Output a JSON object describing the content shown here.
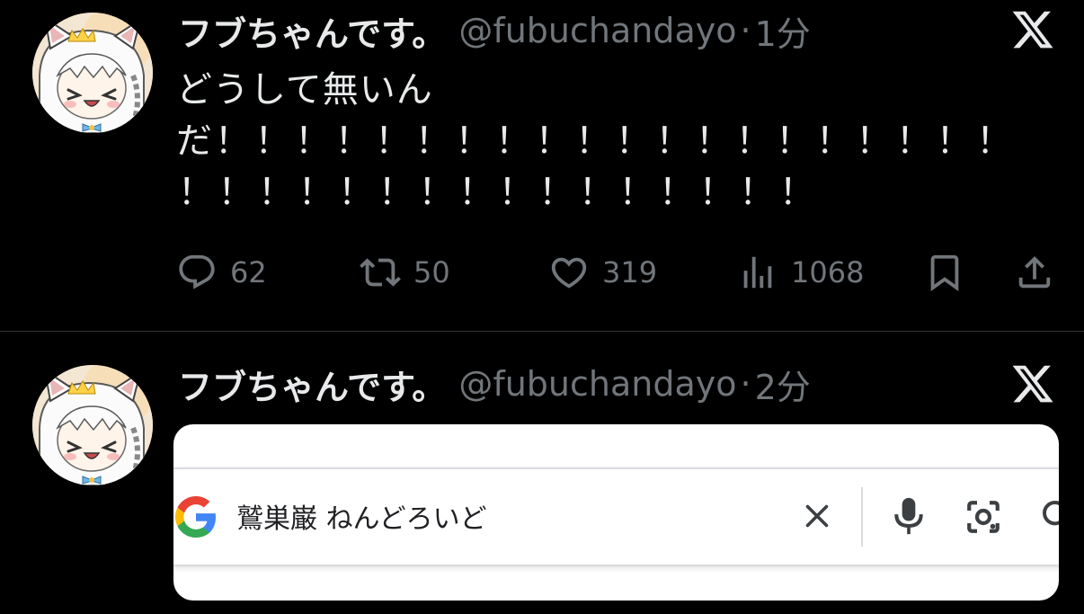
{
  "tweets": [
    {
      "display_name": "フブちゃんです。",
      "handle": "@fubuchandayo",
      "separator": "·",
      "time": "1分",
      "text_line1": "どうして無いん",
      "text_line2_prefix": "だ",
      "text_line2_bangs": "！！！！！！！！！！！！！！！！！！！！",
      "text_line3_bangs": "！！！！！！！！！！！！！！！！",
      "stats": {
        "replies": "62",
        "retweets": "50",
        "likes": "319",
        "views": "1068"
      }
    },
    {
      "display_name": "フブちゃんです。",
      "handle": "@fubuchandayo",
      "separator": "·",
      "time": "2分",
      "search_card": {
        "query": "鷲巣巌 ねんどろいど"
      }
    }
  ],
  "icons": {
    "platform_logo": "x-logo-icon",
    "reply": "speech-bubble-icon",
    "retweet": "retweet-icon",
    "like": "heart-icon",
    "views": "bar-chart-icon",
    "bookmark": "bookmark-icon",
    "share": "share-icon",
    "search_card": [
      "google-g-icon",
      "close-icon",
      "microphone-icon",
      "camera-lens-icon",
      "search-icon"
    ]
  },
  "colors": {
    "background": "#000000",
    "text_primary": "#e7e9ea",
    "text_secondary": "#71767b",
    "divider": "#2f3336",
    "google_blue": "#4285F4",
    "google_red": "#EA4335",
    "google_yellow": "#FBBC05",
    "google_green": "#34A853"
  }
}
